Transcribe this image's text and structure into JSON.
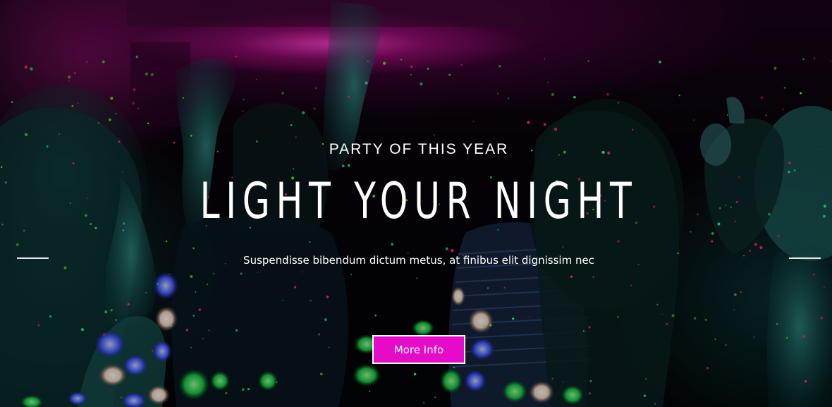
{
  "hero": {
    "eyebrow": "PARTY OF THIS YEAR",
    "headline": "LIGHT YOUR NIGHT",
    "subtitle": "Suspendisse bibendum dictum metus, at finibus elit dignissim nec",
    "cta_label": "More Info"
  },
  "slider": {
    "prev_icon": "arrow-left-line-icon",
    "next_icon": "arrow-right-line-icon"
  },
  "colors": {
    "accent": "#e60bc9",
    "text": "#ffffff"
  }
}
